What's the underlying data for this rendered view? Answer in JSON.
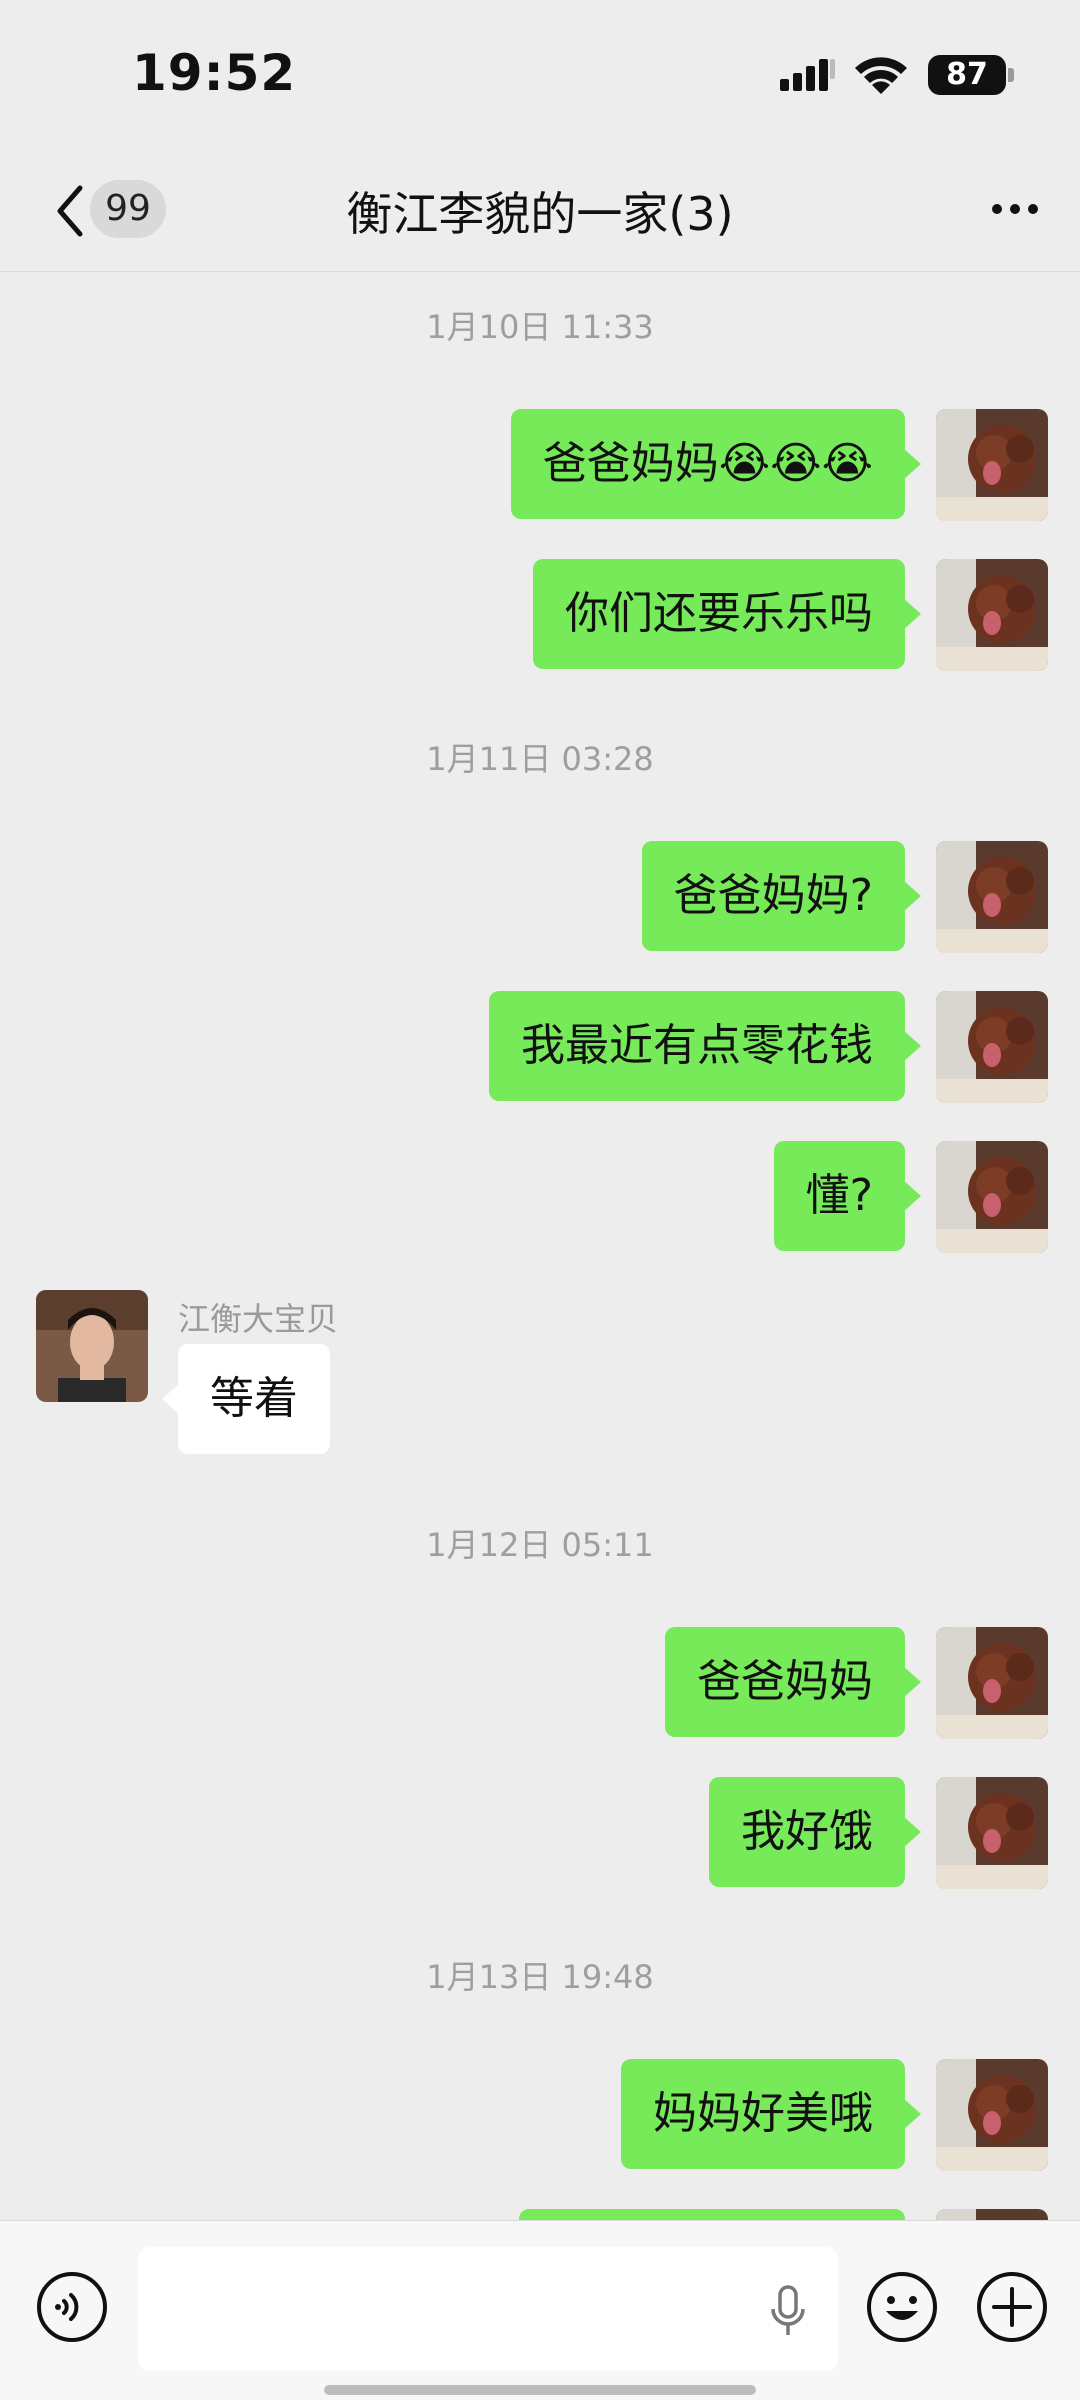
{
  "status_bar": {
    "time": "19:52",
    "battery": "87"
  },
  "nav": {
    "back_badge": "99",
    "title": "衡江李貌的一家(3)"
  },
  "messages": {
    "ts1": "1月10日 11:33",
    "m1": "爸爸妈妈😭😭😭",
    "m2": "你们还要乐乐吗",
    "ts2": "1月11日 03:28",
    "m3": "爸爸妈妈?",
    "m4": "我最近有点零花钱",
    "m5": "懂?",
    "sender1": "江衡大宝贝",
    "m6": "等着",
    "ts3": "1月12日 05:11",
    "m7": "爸爸妈妈",
    "m8": "我好饿",
    "ts4": "1月13日 19:48",
    "m9": "妈妈好美哦"
  },
  "input": {
    "value": "",
    "placeholder": ""
  },
  "colors": {
    "outgoing_bubble": "#77ea5a",
    "incoming_bubble": "#ffffff",
    "background": "#ededed"
  }
}
